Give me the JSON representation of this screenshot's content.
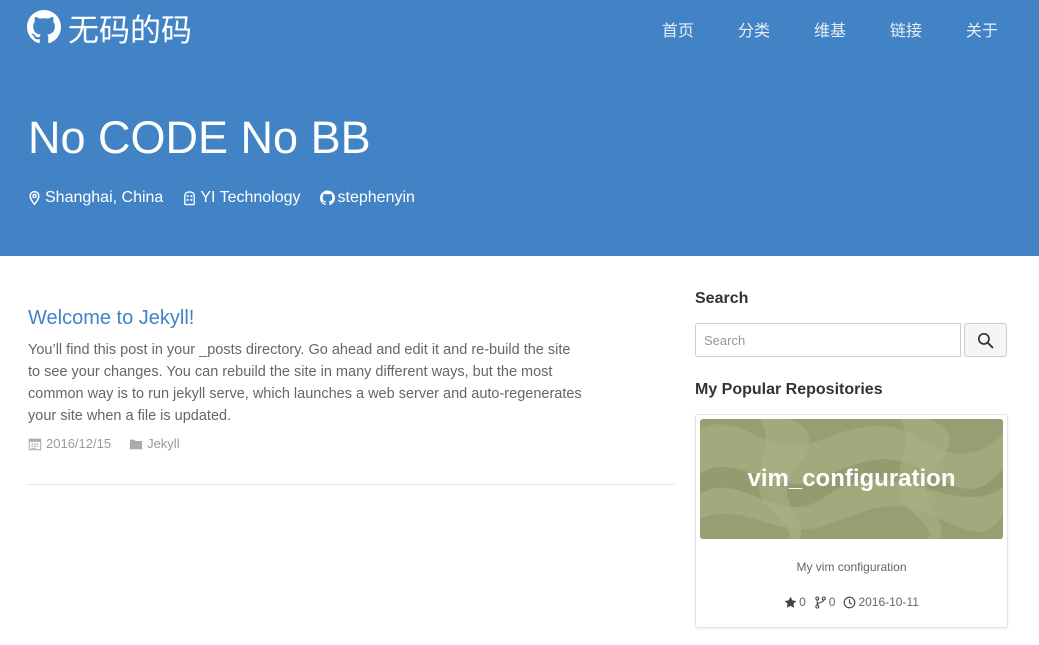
{
  "brand": {
    "name": "无码的码",
    "icon": "github-icon"
  },
  "nav": {
    "items": [
      "首页",
      "分类",
      "维基",
      "链接",
      "关于"
    ]
  },
  "hero": {
    "title": "No CODE No BB",
    "location": "Shanghai, China",
    "company": "YI Technology",
    "github_user": "stephenyin"
  },
  "post": {
    "title": "Welcome to Jekyll!",
    "excerpt": "You’ll find this post in your _posts directory. Go ahead and edit it and re-build the site to see your changes. You can rebuild the site in many different ways, but the most common way is to run jekyll serve, which launches a web server and auto-regenerates your site when a file is updated.",
    "date": "2016/12/15",
    "category": "Jekyll"
  },
  "sidebar": {
    "search_heading": "Search",
    "search_placeholder": "Search",
    "repos_heading": "My Popular Repositories",
    "repo": {
      "name": "vim_configuration",
      "description": "My vim configuration",
      "stars": "0",
      "forks": "0",
      "updated": "2016-10-11"
    }
  },
  "colors": {
    "header_bg": "#4183c4",
    "link": "#4183c4",
    "repo_banner": "#a3a87d"
  }
}
